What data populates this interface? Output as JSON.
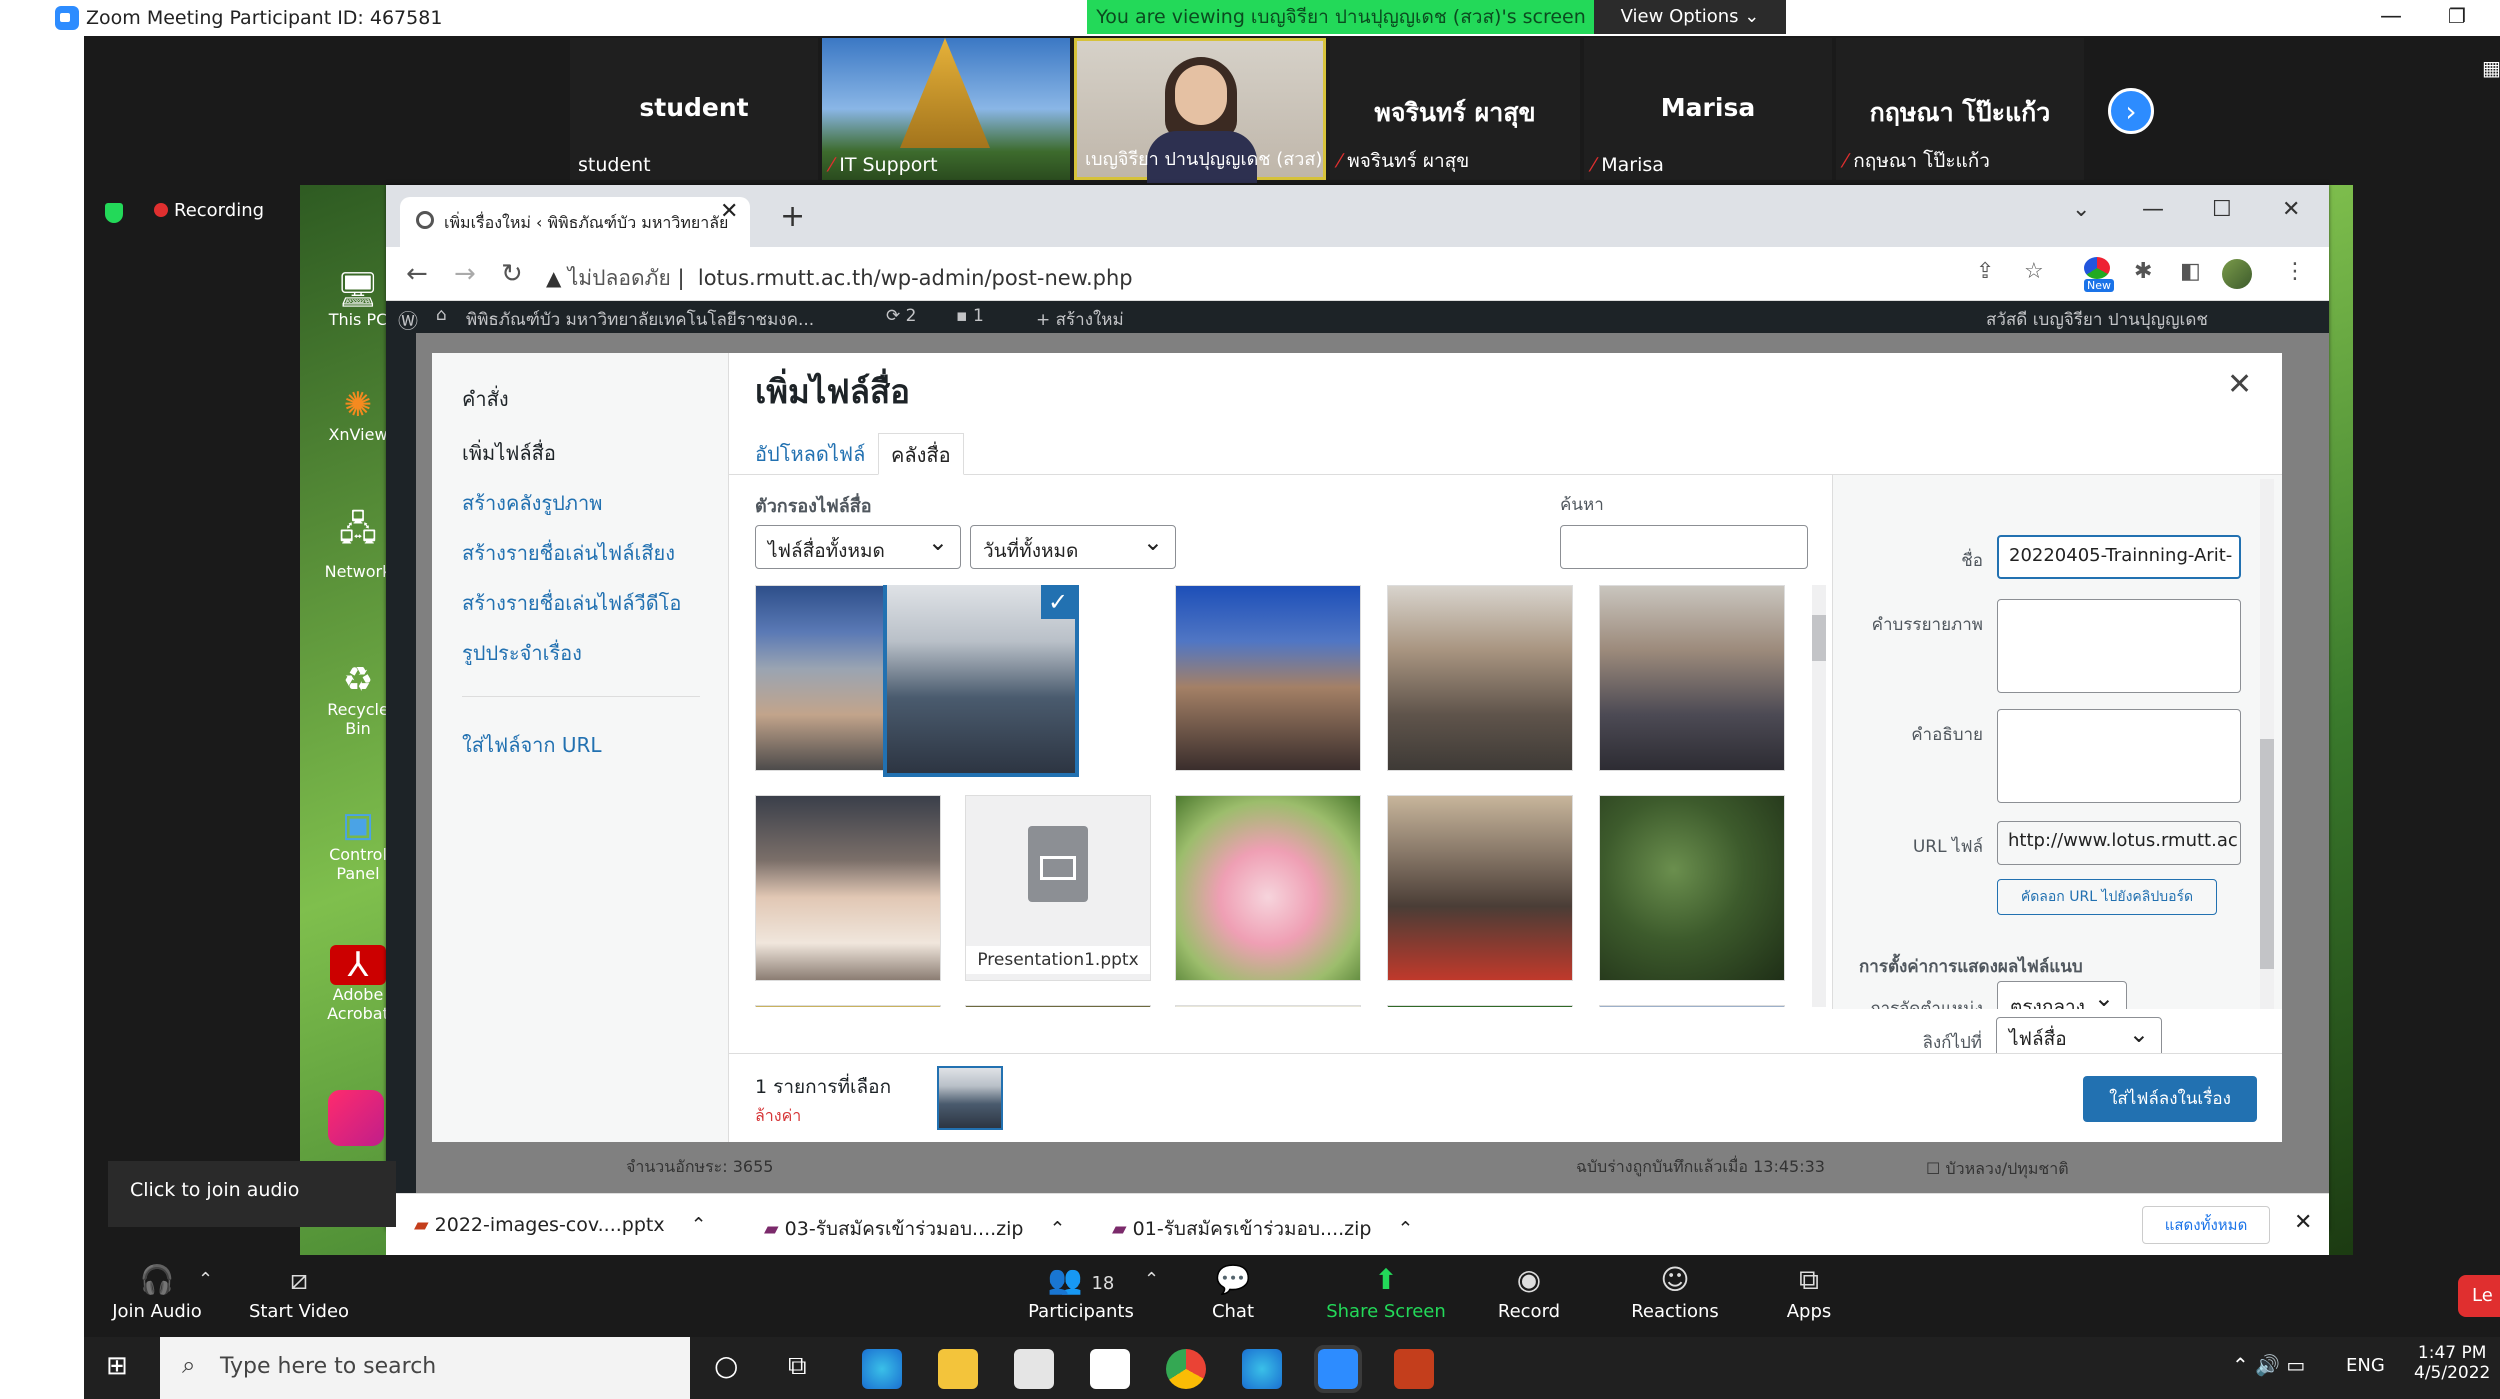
{
  "zoom": {
    "title": "Zoom Meeting Participant ID: 467581",
    "viewing": "You are viewing เบญจิรียา ปานปุญญเดช (สวส)'s screen",
    "view_options": "View Options ⌄",
    "recording": "Recording",
    "participants": [
      {
        "big": "student",
        "label": "student"
      },
      {
        "big": "",
        "label": "IT Support"
      },
      {
        "big": "",
        "label": "เบญจิรียา ปานปุญญเดช (สวส)"
      },
      {
        "big": "พจรินทร์ ผาสุข",
        "label": "พจรินทร์ ผาสุข"
      },
      {
        "big": "Marisa",
        "label": "Marisa"
      },
      {
        "big": "กฤษณา โป๊ะแก้ว",
        "label": "กฤษณา โป๊ะแก้ว"
      }
    ],
    "audio_tip": "Click to join audio",
    "toolbar": {
      "join_audio": "Join Audio",
      "start_video": "Start Video",
      "participants": "Participants",
      "participants_count": "18",
      "chat": "Chat",
      "share": "Share Screen",
      "record": "Record",
      "reactions": "Reactions",
      "apps": "Apps"
    },
    "leave": "Le"
  },
  "desktop_icons": [
    "This PC",
    "XnView",
    "Network",
    "Recycle Bin",
    "Control Panel",
    "Adobe Acrobat"
  ],
  "browser": {
    "tab_title": "เพิ่มเรื่องใหม่ ‹ พิพิธภัณฑ์บัว มหาวิทยาลัย",
    "insecure": "ไม่ปลอดภัย",
    "url": "lotus.rmutt.ac.th/wp-admin/post-new.php",
    "wp_site": "พิพิธภัณฑ์บัว มหาวิทยาลัยเทคโนโลยีราชมงค...",
    "wp_updates": "2",
    "wp_comments": "1",
    "wp_new": "สร้างใหม่",
    "wp_greeting": "สวัสดี เบญจิรียา ปานปุญญเดช",
    "new_badge": "New"
  },
  "modal": {
    "menu_title": "คำสั่ง",
    "menu": [
      "เพิ่มไฟล์สื่อ",
      "สร้างคลังรูปภาพ",
      "สร้างรายชื่อเล่นไฟล์เสียง",
      "สร้างรายชื่อเล่นไฟล์วีดีโอ",
      "รูปประจำเรื่อง"
    ],
    "menu_url": "ใส่ไฟล์จาก URL",
    "title": "เพิ่มไฟล์สื่อ",
    "tab_upload": "อัปโหลดไฟล์",
    "tab_library": "คลังสื่อ",
    "filter_label": "ตัวกรองไฟล์สื่อ",
    "filter_type": "ไฟล์สื่อทั้งหมด",
    "filter_date": "วันที่ทั้งหมด",
    "search_label": "ค้นหา",
    "pptx_name": "Presentation1.pptx",
    "details": {
      "title_label": "ชื่อ",
      "title_value": "20220405-Trainning-Arit-",
      "caption_label": "คำบรรยายภาพ",
      "desc_label": "คำอธิบาย",
      "url_label": "URL ไฟล์",
      "url_value": "http://www.lotus.rmutt.ac",
      "copy_btn": "คัดลอก URL ไปยังคลิปบอร์ด",
      "display_heading": "การตั้งค่าการแสดงผลไฟล์แนบ",
      "align_label": "การจัดตำแหน่ง",
      "align_value": "ตรงกลาง",
      "link_label": "ลิงก์ไปที่",
      "link_value": "ไฟล์สื่อ"
    },
    "selected_count": "1 รายการที่เลือก",
    "clear": "ล้างค่า",
    "insert_btn": "ใส่ไฟล์ลงในเรื่อง"
  },
  "behind": {
    "wordcount": "จำนวนอักษระ: 3655",
    "draft_saved": "ฉบับร่างถูกบันทึกแล้วเมื่อ 13:45:33",
    "category": "บัวหลวง/ปทุมชาติ"
  },
  "downloads": {
    "files": [
      "2022-images-cov....pptx",
      "03-รับสมัครเข้าร่วมอบ....zip",
      "01-รับสมัครเข้าร่วมอบ....zip"
    ],
    "show_all": "แสดงทั้งหมด"
  },
  "taskbar": {
    "search": "Type here to search",
    "lang": "ENG",
    "time": "1:47 PM",
    "date": "4/5/2022"
  }
}
